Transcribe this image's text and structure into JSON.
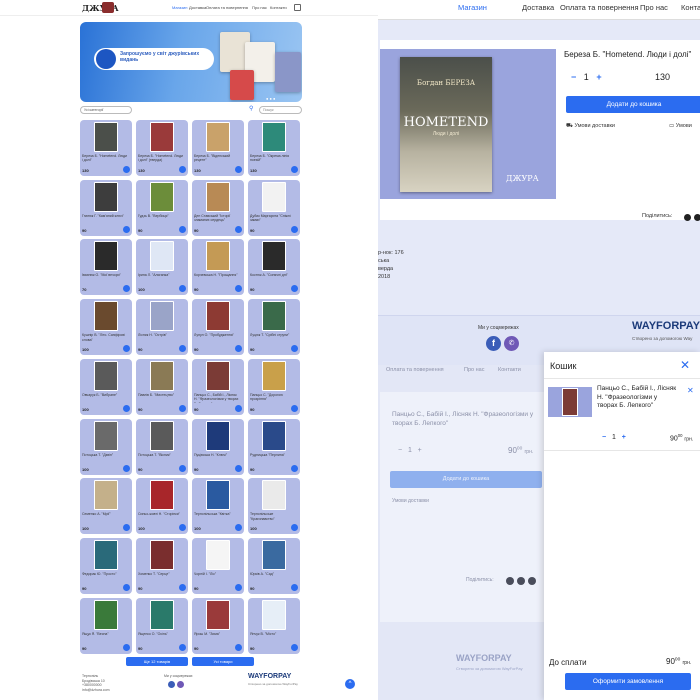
{
  "left": {
    "logo": "ДЖУРА",
    "nav": [
      {
        "label": "Магазин",
        "active": true
      },
      {
        "label": "Доставка",
        "active": false
      },
      {
        "label": "Оплата та повернення",
        "active": false
      },
      {
        "label": "Про нас",
        "active": false
      },
      {
        "label": "Контакти",
        "active": false
      }
    ],
    "banner_text": "Запрошуємо у світ джурівських видань",
    "filter_label": "Усі категорії",
    "search_placeholder": "Пошук",
    "products": [
      {
        "title": "Береза Б. \"Hometend. Люди і долі\"",
        "price": "130",
        "cover": "#4b4f4a"
      },
      {
        "title": "Береза Б. \"Hometend. Люди і долі\" (тверда)",
        "price": "130",
        "cover": "#9a3a3a"
      },
      {
        "title": "Береза Б. \"Віденський рецепт\"",
        "price": "130",
        "cover": "#c9a26a"
      },
      {
        "title": "Береза Б. \"Окрема лінія поезій\"",
        "price": "130",
        "cover": "#2d8a7a"
      },
      {
        "title": "Гнатюк Г. \"Кам'яний ключ\"",
        "price": "90",
        "cover": "#3d3d3d"
      },
      {
        "title": "Гудзь В. \"Вербиця\"",
        "price": "90",
        "cover": "#6c8d3a"
      },
      {
        "title": "Ден Ставський \"Історії зламаних сердець\"",
        "price": "90",
        "cover": "#b88a55"
      },
      {
        "title": "Дубик Маргарита \"Сніжні замки\"",
        "price": "90",
        "cover": "#f2f2f2"
      },
      {
        "title": "Івахнюк О. \"Мої вечори\"",
        "price": "70",
        "cover": "#2a2a2a"
      },
      {
        "title": "Ірина Л. \"Альтанка\"",
        "price": "100",
        "cover": "#dfe7f5"
      },
      {
        "title": "Корчевська Н. \"Прощання\"",
        "price": "90",
        "cover": "#c49a55"
      },
      {
        "title": "Костюк А. \"Сонячні дні\"",
        "price": "90",
        "cover": "#2a2a2a"
      },
      {
        "title": "Кушнір В. \"Літо. Сапфірові слова\"",
        "price": "100",
        "cover": "#6a4a2e"
      },
      {
        "title": "Лісник Н. \"Острів\"",
        "price": "90",
        "cover": "#9aa4c8"
      },
      {
        "title": "Лупул О. \"Пробудження\"",
        "price": "90",
        "cover": "#8d3a33"
      },
      {
        "title": "Луцюк Т. \"Срібні струни\"",
        "price": "90",
        "cover": "#3a6a4a"
      },
      {
        "title": "Овчарук Б. \"Вибране\"",
        "price": "100",
        "cover": "#5a5a5a"
      },
      {
        "title": "Павлів Б. \"Мистецтво\"",
        "price": "90",
        "cover": "#8a7a55"
      },
      {
        "title": "Панцьо С., Бабій І., Лісняк Н. \"Фразеологізми у творах Б. Лепкого\"",
        "price": "90",
        "cover": "#7b3b36"
      },
      {
        "title": "Панцьо С. \"Дорогою прозріння\"",
        "price": "90",
        "cover": "#c9a04a"
      },
      {
        "title": "Потоцька Т. \"Дзвін\"",
        "price": "100",
        "cover": "#6a6a6a"
      },
      {
        "title": "Потоцька Т. \"Вісник\"",
        "price": "90",
        "cover": "#5a5a5a"
      },
      {
        "title": "Пуцівська Н. \"Ключі\"",
        "price": "90",
        "cover": "#1e3a7a"
      },
      {
        "title": "Рудницька \"Перлина\"",
        "price": "90",
        "cover": "#2a4a8a"
      },
      {
        "title": "Семенко А. \"Мрії\"",
        "price": "100",
        "cover": "#c4b08a"
      },
      {
        "title": "Синьо-жовті Н. \"Сторінки\"",
        "price": "100",
        "cover": "#a8262a"
      },
      {
        "title": "Тернопільська \"Квітка\"",
        "price": "100",
        "cover": "#2a5aa0"
      },
      {
        "title": "Тернопільське \"Краєзнавство\"",
        "price": "100",
        "cover": "#eaeaea"
      },
      {
        "title": "Федорак Ю. \"Просто\"",
        "price": "90",
        "cover": "#2a6a7a"
      },
      {
        "title": "Хоменко Т. \"Серце\"",
        "price": "90",
        "cover": "#7a2e2e"
      },
      {
        "title": "Чорній І. \"Ліс\"",
        "price": "90",
        "cover": "#f5f5f5"
      },
      {
        "title": "Юрків А. \"Сад\"",
        "price": "90",
        "cover": "#3a6aa0"
      },
      {
        "title": "Ящук Я. \"Весна\"",
        "price": "90",
        "cover": "#3a7a3a"
      },
      {
        "title": "Ященко О. \"Осінь\"",
        "price": "90",
        "cover": "#2a7a6a"
      },
      {
        "title": "Ярош М. \"Зима\"",
        "price": "90",
        "cover": "#9a3a3a"
      },
      {
        "title": "Янчук В. \"Місто\"",
        "price": "90",
        "cover": "#e6eef7"
      }
    ],
    "btn_prev": "Ще 12 товарів",
    "btn_all": "Усі товари",
    "footer_col1": [
      "Тернопіль",
      "Бродівська 10",
      "+380000000",
      "info@dzhura.com"
    ],
    "footer_social": "Ми у соцмережах",
    "wfp": "WAYFORPAY",
    "wfp_sub": "Створено за допомогою WayForPay"
  },
  "right": {
    "nav": [
      {
        "label": "Магазин",
        "active": true
      },
      {
        "label": "Доставка",
        "active": false
      },
      {
        "label": "Оплата та повернення",
        "active": false
      },
      {
        "label": "Про нас",
        "active": false
      },
      {
        "label": "Контакти",
        "active": false
      }
    ],
    "product": {
      "title": "Береза Б. \"Hometend. Люди і долі\"",
      "book_author": "Богдан БЕРЕЗА",
      "book_title": "HOMETEND",
      "book_sub": "Люди і долі",
      "logo": "ДЖУРА",
      "qty": "1",
      "price": "130",
      "add_to_cart": "Додати до кошика",
      "delivery": "Умови доставки",
      "terms": "Умови",
      "share": "Поділитись:",
      "details": [
        "р-нок: 176",
        "ська",
        "верда",
        "2018"
      ]
    },
    "social_label": "Ми у соцмережах",
    "wfp": "WAYFORPAY",
    "wfp_sub": "Створено за допомогою Way",
    "ghost": {
      "nav": [
        "Оплата та повернення",
        "Про нас",
        "Контакти"
      ],
      "title": "Панцьо С., Бабій І., Лісняк Н. \"Фразеологізми у творах Б. Лепкого\"",
      "qty": "1",
      "price": "90",
      "currency": "грн.",
      "add_to_cart": "Додати до кошика",
      "delivery": "Умови доставки",
      "share": "Поділитись:",
      "wfp": "WAYFORPAY",
      "wfp_sub": "Створено за допомогою WayForPay"
    }
  },
  "cart": {
    "title": "Кошик",
    "item_name": "Панцьо С., Бабій І., Лісняк Н. \"Фразеологізми у творах Б. Лепкого\"",
    "qty": "1",
    "price": "90",
    "kop": "00",
    "currency": "грн.",
    "total_label": "До сплати",
    "total": "90",
    "order_btn": "Оформити замовлення"
  },
  "colors": {
    "accent": "#2b6cf0",
    "card_bg": "#b3bbe6",
    "image_bg": "#9aa4dd"
  }
}
